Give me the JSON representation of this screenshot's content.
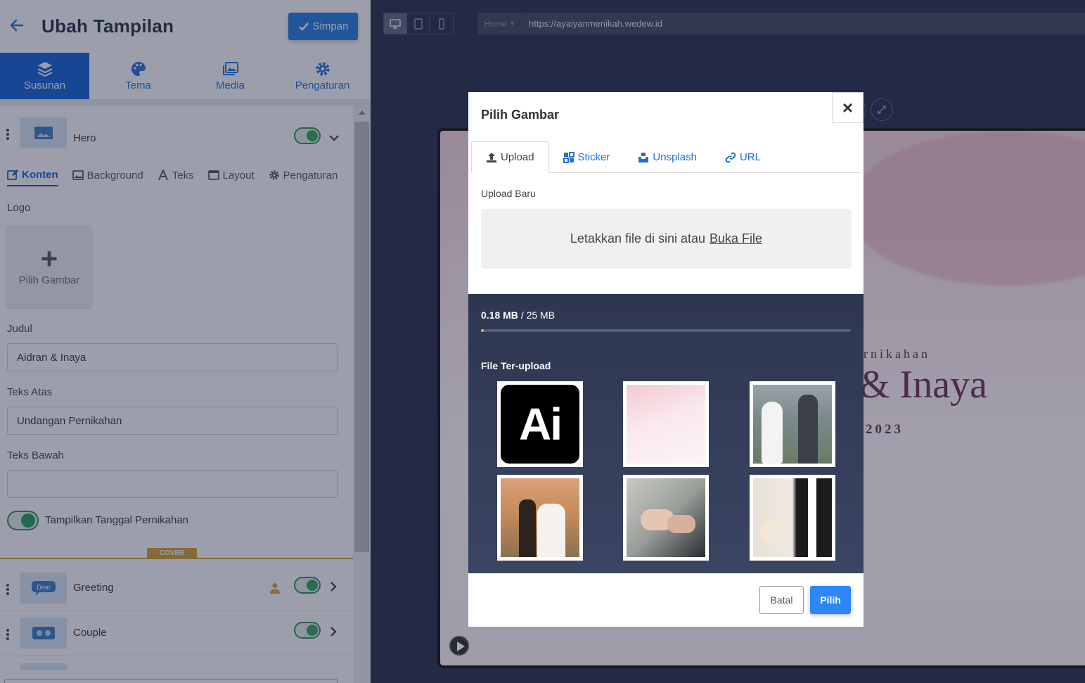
{
  "header": {
    "title": "Ubah Tampilan",
    "save_label": "Simpan"
  },
  "main_tabs": [
    {
      "label": "Susunan",
      "icon": "layers-icon",
      "active": true
    },
    {
      "label": "Tema",
      "icon": "palette-icon",
      "active": false
    },
    {
      "label": "Media",
      "icon": "images-icon",
      "active": false
    },
    {
      "label": "Pengaturan",
      "icon": "gear-icon",
      "active": false
    }
  ],
  "hero": {
    "label": "Hero",
    "enabled": true,
    "sub_tabs": [
      {
        "label": "Konten",
        "icon": "edit-icon",
        "active": true
      },
      {
        "label": "Background",
        "icon": "image-icon",
        "active": false
      },
      {
        "label": "Teks",
        "icon": "font-icon",
        "active": false
      },
      {
        "label": "Layout",
        "icon": "window-icon",
        "active": false
      },
      {
        "label": "Pengaturan",
        "icon": "gear-icon",
        "active": false
      }
    ],
    "logo_label": "Logo",
    "logo_picker": "Pilih Gambar",
    "judul_label": "Judul",
    "judul_value": "Aidran & Inaya",
    "teks_atas_label": "Teks Atas",
    "teks_atas_value": "Undangan Pernikahan",
    "teks_bawah_label": "Teks Bawah",
    "teks_bawah_value": "",
    "show_date_label": "Tampilkan Tanggal Pernikahan",
    "show_date_enabled": true,
    "cover_badge": "COVER"
  },
  "sections": [
    {
      "label": "Greeting",
      "thumb_text": "Dear",
      "enabled": true
    },
    {
      "label": "Couple",
      "thumb_text": "",
      "enabled": true
    }
  ],
  "preview": {
    "url_select": "Home",
    "url": "https://ayaiyanmenikah.wedew.id",
    "sub_text": "rnikahan",
    "names": "& Inaya",
    "year": "2023"
  },
  "modal": {
    "title": "Pilih Gambar",
    "close_label": "×",
    "tabs": [
      {
        "label": "Upload",
        "icon": "upload-icon",
        "active": true
      },
      {
        "label": "Sticker",
        "icon": "sticker-icon",
        "active": false
      },
      {
        "label": "Unsplash",
        "icon": "unsplash-icon",
        "active": false
      },
      {
        "label": "URL",
        "icon": "link-icon",
        "active": false
      }
    ],
    "upload_new_label": "Upload Baru",
    "drop_text": "Letakkan file di sini atau",
    "drop_link": "Buka File",
    "storage_used": "0.18 MB",
    "storage_total": "/ 25 MB",
    "storage_fraction": 0.0072,
    "uploaded_title": "File Ter-upload",
    "ai_logo_text": "Ai",
    "cancel_label": "Batal",
    "choose_label": "Pilih"
  },
  "colors": {
    "primary": "#0d5ed8",
    "accent_green": "#2ea358",
    "cover_gold": "#d4a02d",
    "progress": "#f3b316"
  }
}
